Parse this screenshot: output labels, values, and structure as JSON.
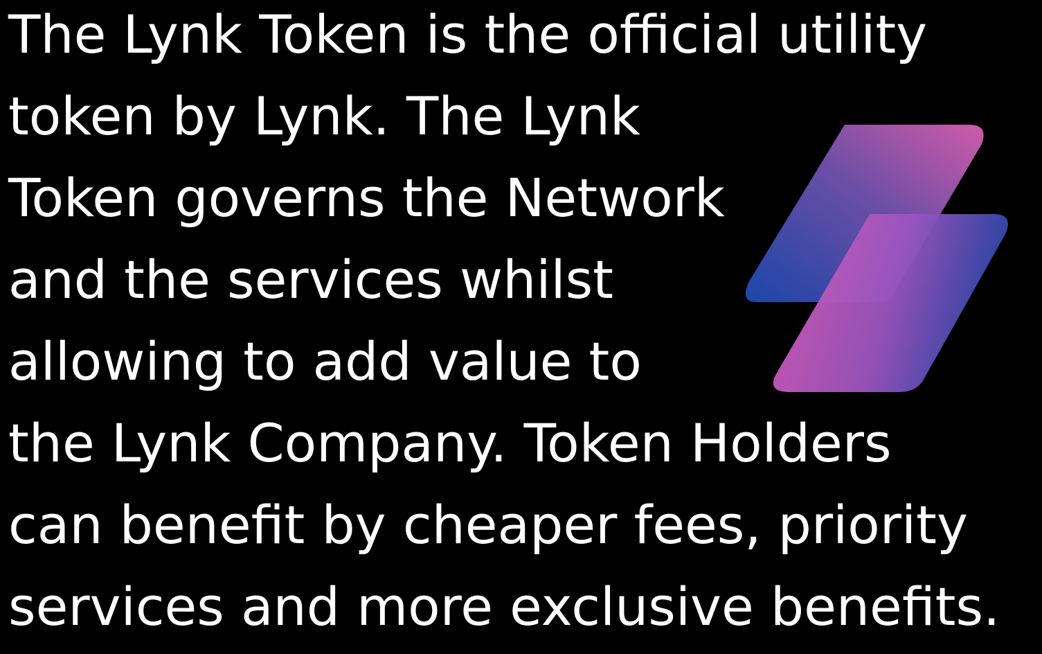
{
  "text": {
    "lines": [
      "The Lynk Token is the official utility",
      "token by Lynk. The Lynk",
      "Token governs the Network",
      "and the services whilst",
      "allowing to add value to",
      "the Lynk Company. Token Holders",
      "can benefit by cheaper fees, priority",
      "services and more exclusive benefits."
    ]
  },
  "logo": {
    "icon": "lynk-logo-icon",
    "colors": {
      "background": "#000000",
      "text": "#ffffff",
      "gradient_blue": "#1b46a8",
      "gradient_purple": "#8a4ea6",
      "gradient_pink": "#d05aa8"
    }
  }
}
